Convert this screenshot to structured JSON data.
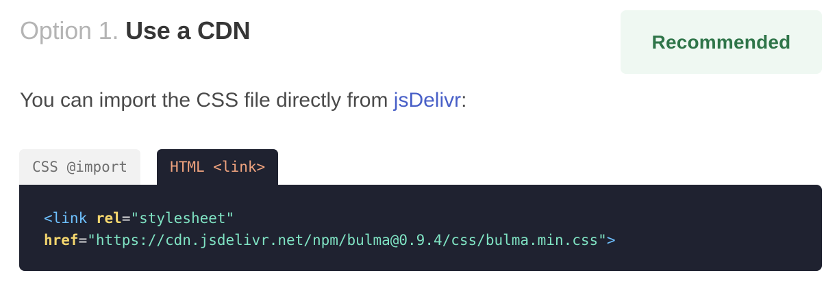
{
  "heading": {
    "prefix": "Option 1.",
    "title": "Use a CDN"
  },
  "badge": {
    "label": "Recommended"
  },
  "description": {
    "text_before": "You can import the CSS file directly from ",
    "link_text": "jsDelivr",
    "text_after": ":"
  },
  "tabs": [
    {
      "label": "CSS @import",
      "active": false
    },
    {
      "label": "HTML <link>",
      "active": true
    }
  ],
  "code": {
    "line1": {
      "tag_open": "<link",
      "attr_name": "rel",
      "equals": "=",
      "attr_value": "\"stylesheet\""
    },
    "line2": {
      "attr_name": "href",
      "equals": "=",
      "attr_value": "\"https://cdn.jsdelivr.net/npm/bulma@0.9.4/css/bulma.min.css\"",
      "tag_close": ">"
    }
  },
  "colors": {
    "badge_background": "#eff8f2",
    "badge_text": "#2f7549",
    "link": "#485fc7",
    "code_background": "#1f2230",
    "active_tab_text": "#f0a37e",
    "code_tag": "#6ec1ff",
    "code_attr": "#f5d76e",
    "code_string": "#7fe3c3"
  }
}
